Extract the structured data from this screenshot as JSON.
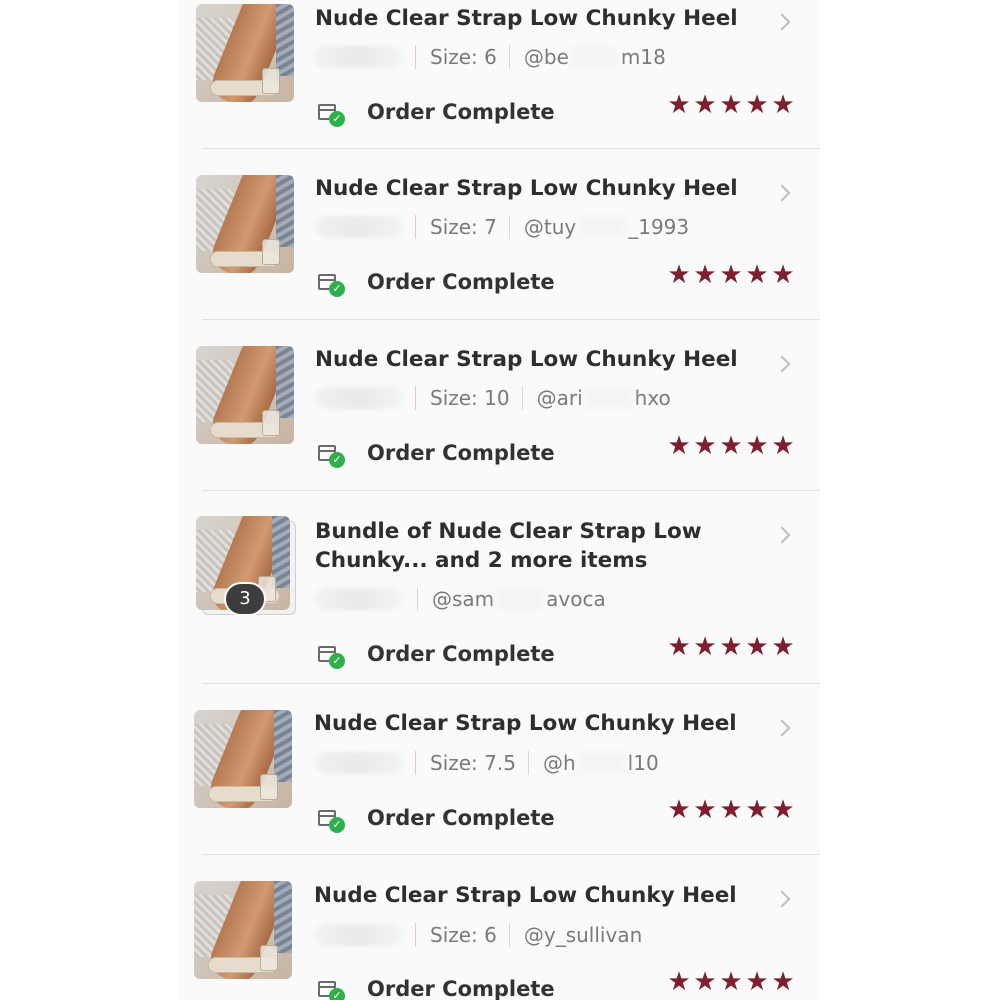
{
  "orders": [
    {
      "title": "Nude Clear Strap Low Chunky Heel",
      "size_label": "Size: 6",
      "username": [
        "@be",
        "m18"
      ],
      "status": "Order Complete",
      "rating": 5
    },
    {
      "title": "Nude Clear Strap Low Chunky Heel",
      "size_label": "Size: 7",
      "username": [
        "@tuy",
        "_1993"
      ],
      "status": "Order Complete",
      "rating": 5
    },
    {
      "title": "Nude Clear Strap Low Chunky Heel",
      "size_label": "Size: 10",
      "username": [
        "@ari",
        "hxo"
      ],
      "status": "Order Complete",
      "rating": 5
    },
    {
      "title": "Bundle of Nude Clear Strap Low Chunky... and 2 more items",
      "item_count": "3",
      "username": [
        "@sam",
        "avoca"
      ],
      "status": "Order Complete",
      "rating": 5
    },
    {
      "title": "Nude Clear Strap Low Chunky Heel",
      "size_label": "Size: 7.5",
      "username": [
        "@h",
        "l10"
      ],
      "status": "Order Complete",
      "rating": 5
    },
    {
      "title": "Nude Clear Strap Low Chunky Heel",
      "size_label": "Size: 6",
      "username": [
        "@y_sullivan",
        ""
      ],
      "status": "Order Complete",
      "rating": 5
    }
  ],
  "icons": {
    "chevron": "chevron-right-icon",
    "status": "package-check-icon",
    "star": "star-icon"
  },
  "colors": {
    "star": "#7d1f2e",
    "check": "#2fb04a"
  }
}
